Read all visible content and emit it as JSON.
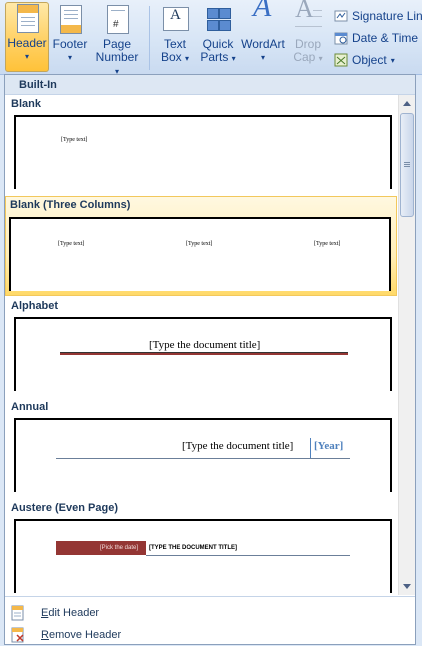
{
  "ribbon": {
    "header": {
      "label": "Header"
    },
    "footer": {
      "label": "Footer"
    },
    "page_number": {
      "line1": "Page",
      "line2": "Number"
    },
    "text_box": {
      "line1": "Text",
      "line2": "Box"
    },
    "quick_parts": {
      "line1": "Quick",
      "line2": "Parts"
    },
    "wordart": {
      "label": "WordArt"
    },
    "drop_cap": {
      "line1": "Drop",
      "line2": "Cap"
    },
    "signature_line": {
      "label": "Signature Line"
    },
    "date_time": {
      "label": "Date & Time"
    },
    "object": {
      "label": "Object"
    },
    "dropdown_glyph": "▾"
  },
  "gallery": {
    "section_title": "Built-In",
    "items": [
      {
        "name": "Blank",
        "placeholder": "[Type text]"
      },
      {
        "name": "Blank (Three Columns)",
        "col1": "[Type text]",
        "col2": "[Type text]",
        "col3": "[Type text]"
      },
      {
        "name": "Alphabet",
        "title": "[Type the document title]"
      },
      {
        "name": "Annual",
        "title": "[Type the document title]",
        "year": "[Year]"
      },
      {
        "name": "Austere (Even Page)",
        "date": "[Pick the date]",
        "title": "[TYPE THE DOCUMENT TITLE]"
      }
    ]
  },
  "menu": {
    "edit": {
      "prefix": "E",
      "rest": "dit Header"
    },
    "remove": {
      "prefix": "R",
      "rest": "emove Header"
    }
  },
  "colors": {
    "highlight": "#ffd968",
    "accent": "#15428b",
    "alphabet_line": "#943634",
    "austere_date_bg": "#943634",
    "annual_year": "#4f81bd"
  }
}
